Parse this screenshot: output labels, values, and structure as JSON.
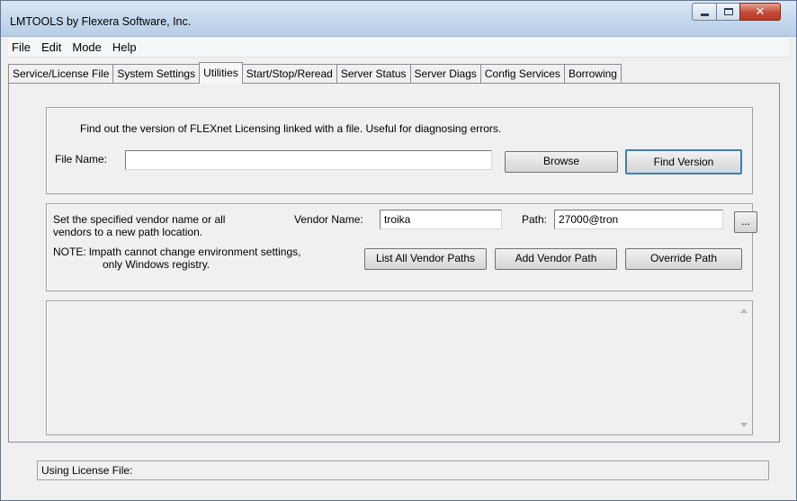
{
  "window": {
    "title": "LMTOOLS by Flexera Software, Inc."
  },
  "menu": [
    "File",
    "Edit",
    "Mode",
    "Help"
  ],
  "tabs": [
    {
      "label": "Service/License File",
      "active": false
    },
    {
      "label": "System Settings",
      "active": false
    },
    {
      "label": "Utilities",
      "active": true
    },
    {
      "label": "Start/Stop/Reread",
      "active": false
    },
    {
      "label": "Server Status",
      "active": false
    },
    {
      "label": "Server Diags",
      "active": false
    },
    {
      "label": "Config Services",
      "active": false
    },
    {
      "label": "Borrowing",
      "active": false
    }
  ],
  "find_version": {
    "description": "Find out the version of FLEXnet Licensing linked with a file.  Useful for diagnosing errors.",
    "file_name_label": "File Name:",
    "file_name_value": "",
    "browse_label": "Browse",
    "find_version_label": "Find Version"
  },
  "vendor_path": {
    "description_line1": "Set the specified vendor name or all",
    "description_line2": "vendors to a new path location.",
    "vendor_name_label": "Vendor Name:",
    "vendor_name_value": "troika",
    "path_label": "Path:",
    "path_value": "27000@tron",
    "ellipsis_label": "...",
    "note_line1": "NOTE:  lmpath cannot change environment settings,",
    "note_line2": "only Windows registry.",
    "list_all_label": "List All Vendor Paths",
    "add_label": "Add Vendor Path",
    "override_label": "Override Path"
  },
  "output": {
    "text": ""
  },
  "status": {
    "text": "Using License File:"
  },
  "icons": {
    "minimize": "minimize-icon",
    "maximize": "maximize-icon",
    "close": "close-icon"
  }
}
